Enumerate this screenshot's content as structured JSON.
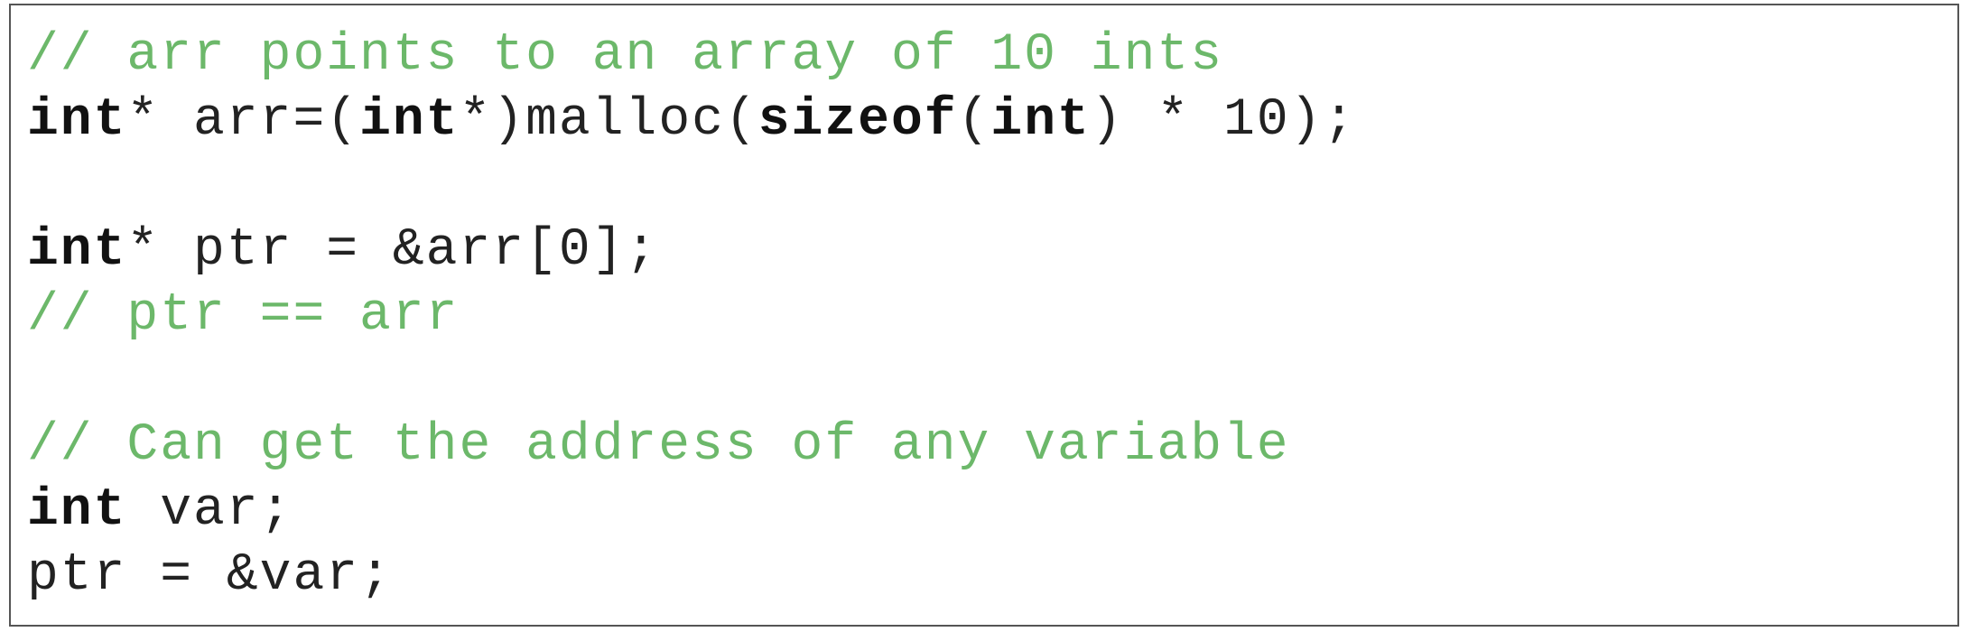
{
  "code": {
    "lines": [
      {
        "type": "comment",
        "text": "// arr points to an array of 10 ints"
      },
      {
        "type": "code",
        "segments": [
          {
            "kind": "keyword",
            "text": "int"
          },
          {
            "kind": "plain",
            "text": "* arr=("
          },
          {
            "kind": "keyword",
            "text": "int"
          },
          {
            "kind": "plain",
            "text": "*)malloc("
          },
          {
            "kind": "keyword",
            "text": "sizeof"
          },
          {
            "kind": "plain",
            "text": "("
          },
          {
            "kind": "keyword",
            "text": "int"
          },
          {
            "kind": "plain",
            "text": ") * 10);"
          }
        ]
      },
      {
        "type": "blank"
      },
      {
        "type": "code",
        "segments": [
          {
            "kind": "keyword",
            "text": "int"
          },
          {
            "kind": "plain",
            "text": "* ptr = &arr[0];"
          }
        ]
      },
      {
        "type": "comment",
        "text": "// ptr == arr"
      },
      {
        "type": "blank"
      },
      {
        "type": "comment",
        "text": "// Can get the address of any variable"
      },
      {
        "type": "code",
        "segments": [
          {
            "kind": "keyword",
            "text": "int"
          },
          {
            "kind": "plain",
            "text": " var;"
          }
        ]
      },
      {
        "type": "code",
        "segments": [
          {
            "kind": "plain",
            "text": "ptr = &var;"
          }
        ]
      }
    ]
  },
  "colors": {
    "comment": "#6cb86a",
    "keyword": "#111111",
    "plain": "#222222",
    "border": "#555555"
  }
}
